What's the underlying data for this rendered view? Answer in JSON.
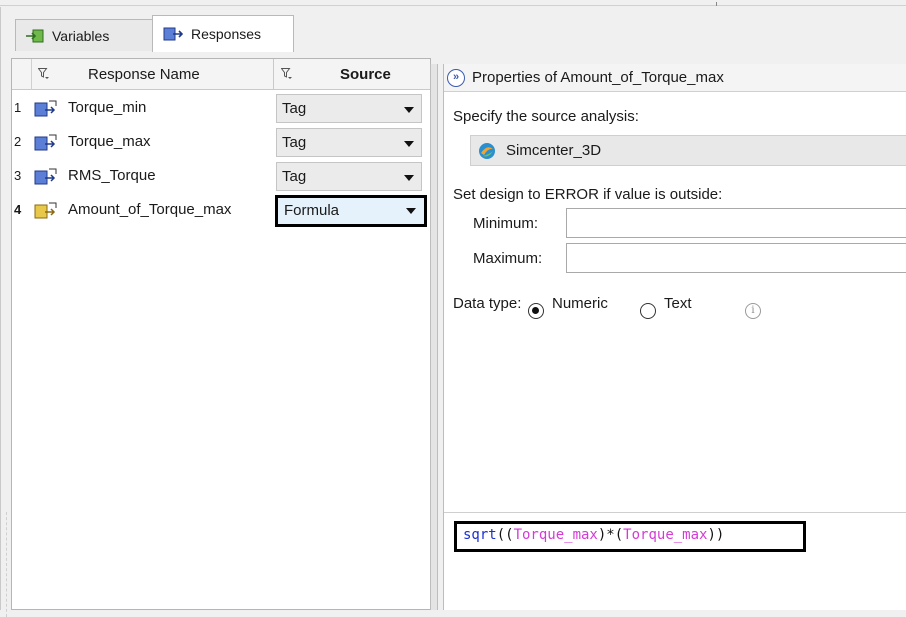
{
  "tabs": [
    {
      "label": "Variables",
      "icon": "variables-icon"
    },
    {
      "label": "Responses",
      "icon": "responses-icon"
    }
  ],
  "grid": {
    "headers": {
      "name": "Response Name",
      "source": "Source"
    },
    "rows": [
      {
        "num": "1",
        "name": "Torque_min",
        "source": "Tag"
      },
      {
        "num": "2",
        "name": "Torque_max",
        "source": "Tag"
      },
      {
        "num": "3",
        "name": "RMS_Torque",
        "source": "Tag"
      },
      {
        "num": "4",
        "name": "Amount_of_Torque_max",
        "source": "Formula"
      }
    ]
  },
  "properties": {
    "expand_symbol": "»",
    "title": "Properties of Amount_of_Torque_max",
    "source_label": "Specify the source analysis:",
    "source_value": "Simcenter_3D",
    "error_label": "Set design to ERROR if value is outside:",
    "minimum_label": "Minimum:",
    "minimum_value": "",
    "maximum_label": "Maximum:",
    "maximum_value": "",
    "data_type_label": "Data type:",
    "numeric_label": "Numeric",
    "text_label": "Text",
    "data_type_selected": "Numeric",
    "info_symbol": "i"
  },
  "formula": {
    "fn": "sqrt",
    "open1": "((",
    "var1": "Torque_max",
    "mid": ")*(",
    "var2": "Torque_max",
    "close1": "))"
  },
  "colors": {
    "formula_function": "#1a2fd6",
    "formula_variable": "#d63ad6",
    "selected_cell": "#e5f1fb"
  }
}
